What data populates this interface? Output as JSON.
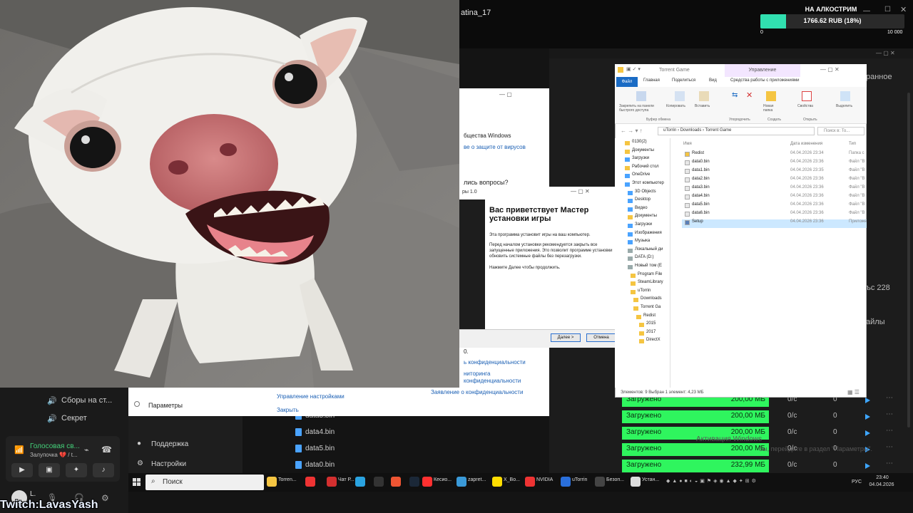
{
  "stream": {
    "streamer_name": "atina_17",
    "alert_title": "НА АЛКОСТРИМ",
    "progress_text": "1766.62 RUB (18%)",
    "progress_fraction": 0.18,
    "progress_min": "0",
    "progress_max": "10 000",
    "twitch_label": "Twitch:LavasYash"
  },
  "left_panel": {
    "item1": "Сборы на ст...",
    "item2": "Секрет",
    "voice_title": "Голосовая св...",
    "voice_sub": "Залупочка 💔 / t...",
    "user_initial": "L."
  },
  "settings_menu": {
    "support": "Поддержка",
    "settings": "Настройки"
  },
  "win_security": {
    "line1": "бщества Windows",
    "link1": "ве о защите от вирусов",
    "line2": "лись вопросы?",
    "line3": "0.",
    "link2": "ь конфиденциальности",
    "link3": "ниторинга",
    "link4": "конфиденциальности",
    "params_label": "Параметры",
    "manage_settings": "Управление настройками",
    "close": "Закрыть",
    "privacy_statement": "Заявление о конфиденциальности"
  },
  "installer": {
    "title": "ры 1.0",
    "heading": "Вас приветствует Мастер установки игры",
    "p1": "Эта программа установит игры на ваш компьютер.",
    "p2": "Перед началом установки рекомендуется закрыть все запущенные приложения. Это позволит программе установки обновить системные файлы без перезагрузки.",
    "p3": "Нажмите Далее чтобы продолжить.",
    "next_btn": "Далее >",
    "cancel_btn": "Отмена"
  },
  "explorer": {
    "title": "Torrent Game",
    "manage_tab": "Управление",
    "tabs": [
      "Файл",
      "Главная",
      "Поделиться",
      "Вид",
      "Средства работы с приложениями"
    ],
    "ribbon_groups": [
      "Буфер обмена",
      "Упорядочить",
      "Создать",
      "Открыть",
      "Выделить"
    ],
    "ribbon_buttons": [
      "Закрепить на панели быстрого доступа",
      "Копировать",
      "Вставить",
      "Новая папка",
      "Свойства",
      "Выделить"
    ],
    "address": [
      "uTorrin",
      "Downloads",
      "Torrent Game"
    ],
    "search_placeholder": "Поиск в: To...",
    "nav_items": [
      "0130(2)",
      "Документы",
      "Загрузки",
      "Рабочий стол",
      "OneDrive",
      "Этот компьютер",
      "3D Objects",
      "Desktop",
      "Видео",
      "Документы",
      "Загрузки",
      "Изображения",
      "Музыка",
      "Локальный ди",
      "DATA (D:)",
      "Новый том (E",
      "Program File",
      "SteamLibrary",
      "uTorrin",
      "Downloads",
      "Torrent Ga",
      "Redist",
      "2015",
      "2017",
      "DirectX"
    ],
    "columns": [
      "Имя",
      "Дата изменения",
      "Тип"
    ],
    "files": [
      {
        "name": "Redist",
        "date": "04.04.2026 23:34",
        "type": "Папка с"
      },
      {
        "name": "data0.bin",
        "date": "04.04.2026 23:36",
        "type": "Файл \"B"
      },
      {
        "name": "data1.bin",
        "date": "04.04.2026 23:35",
        "type": "Файл \"B"
      },
      {
        "name": "data2.bin",
        "date": "04.04.2026 23:36",
        "type": "Файл \"B"
      },
      {
        "name": "data3.bin",
        "date": "04.04.2026 23:36",
        "type": "Файл \"B"
      },
      {
        "name": "data4.bin",
        "date": "04.04.2026 23:36",
        "type": "Файл \"B"
      },
      {
        "name": "data5.bin",
        "date": "04.04.2026 23:36",
        "type": "Файл \"B"
      },
      {
        "name": "data6.bin",
        "date": "04.04.2026 23:36",
        "type": "Файл \"B"
      },
      {
        "name": "Setup",
        "date": "04.04.2026 23:36",
        "type": "Приложе"
      }
    ],
    "status": "Элементов: 9    Выбран 1 элемент: 4,23 МБ"
  },
  "dark_app": {
    "right_text1": "ранное",
    "right_text2": "ъс 228",
    "right_text3": "айлы"
  },
  "downloads": [
    {
      "file": "",
      "status": "Загружено",
      "size": "200,00 МБ",
      "speed": "0/с",
      "count": "0"
    },
    {
      "file": "data3.bin",
      "status": "Загружено",
      "size": "200,00 МБ",
      "speed": "0/с",
      "count": "0"
    },
    {
      "file": "data4.bin",
      "status": "Загружено",
      "size": "200,00 МБ",
      "speed": "0/с",
      "count": "0"
    },
    {
      "file": "data5.bin",
      "status": "Загружено",
      "size": "200,00 МБ",
      "speed": "0/с",
      "count": "0"
    },
    {
      "file": "data0.bin",
      "status": "Загружено",
      "size": "232,99 МБ",
      "speed": "0/с",
      "count": "0"
    }
  ],
  "watermark": {
    "line1": "Активация Windows",
    "line2": "бы, перейдите в раздел \"Параметры\"."
  },
  "taskbar": {
    "search": "Поиск",
    "apps": [
      "Torren...",
      "Чат Р...",
      "Кесио...",
      "zapret...",
      "Х_Во...",
      "NVIDIA",
      "uTorrin",
      "Безоп...",
      "Устан..."
    ],
    "lang": "РУС",
    "time": "23:40",
    "date": "04.04.2026"
  },
  "colors": {
    "accent_green": "#2ff55e",
    "progress_teal": "#31e0b0",
    "link_blue": "#1a5fb4",
    "play_blue": "#3ea6ff"
  }
}
